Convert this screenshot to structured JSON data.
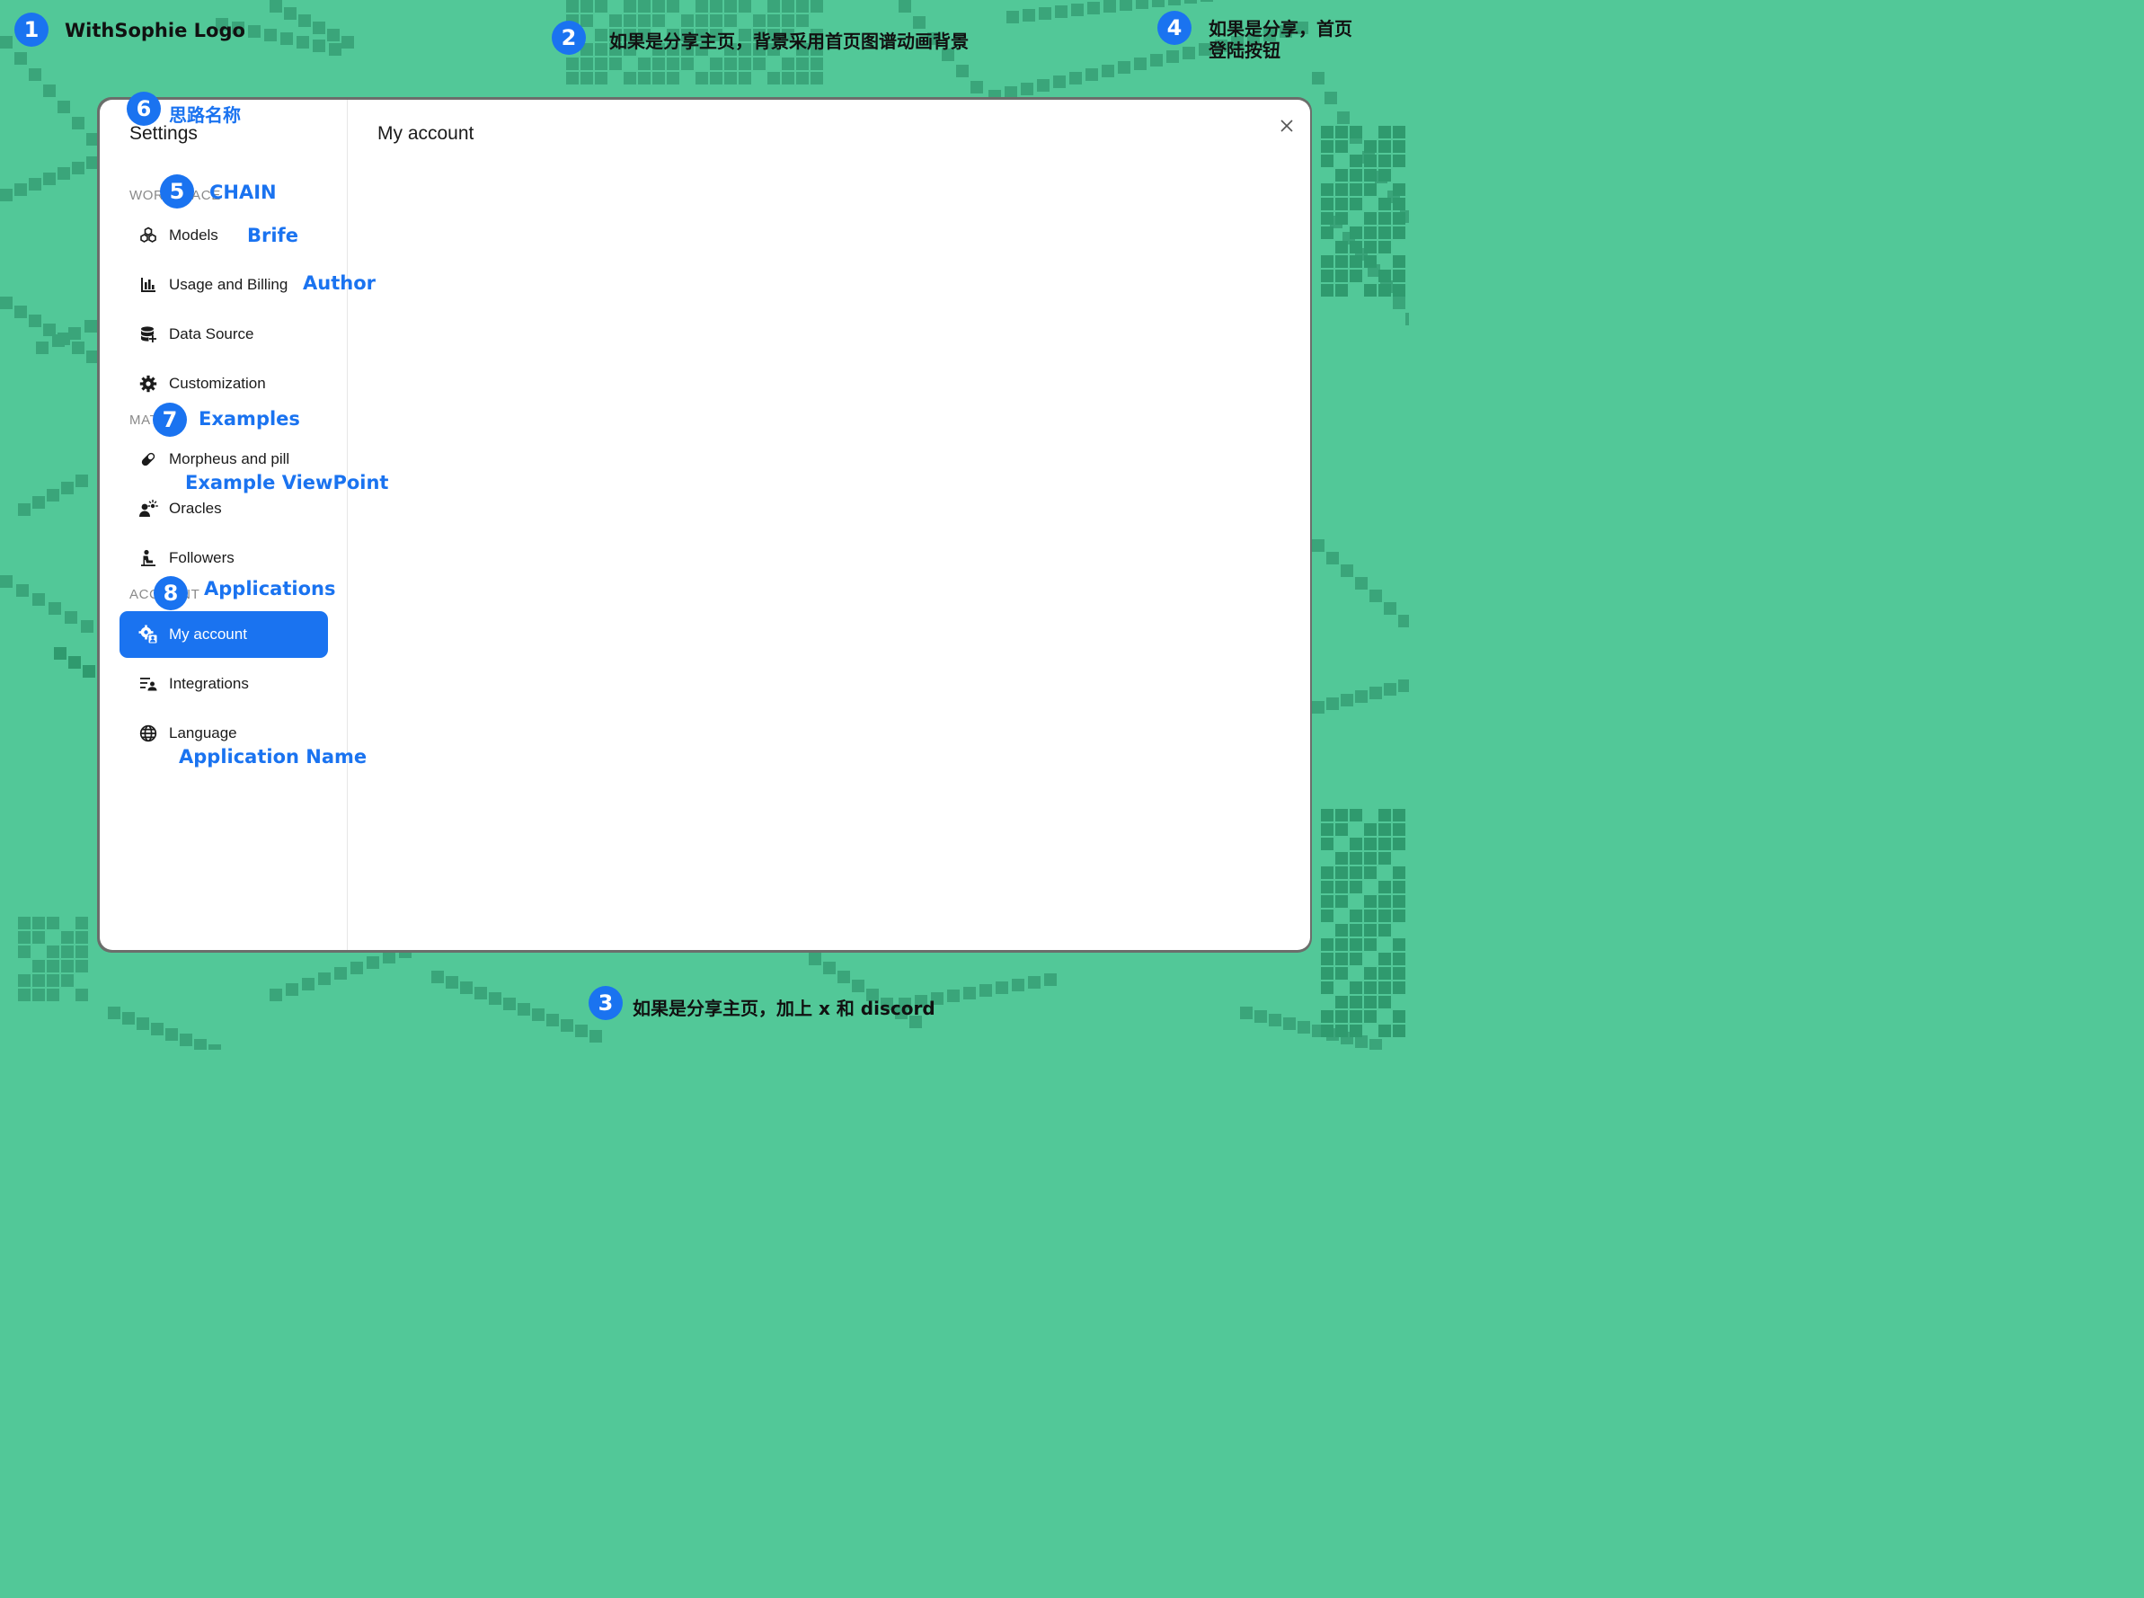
{
  "annotations": {
    "n1": {
      "num": "1",
      "text": "WithSophie Logo"
    },
    "n2": {
      "num": "2",
      "text": "如果是分享主页，背景采用首页图谱动画背景"
    },
    "n3": {
      "num": "3",
      "text": "如果是分享主页，加上 x 和 discord"
    },
    "n4": {
      "num": "4",
      "line1": "如果是分享，首页",
      "line2": "登陆按钮"
    },
    "n5": {
      "num": "5",
      "text": "CHAIN"
    },
    "n6": {
      "num": "6",
      "text": "思路名称"
    },
    "n7": {
      "num": "7",
      "text": "Examples"
    },
    "n8": {
      "num": "8",
      "text": "Applications"
    },
    "brife": "Brife",
    "author": "Author",
    "example_viewpoint": "Example ViewPoint",
    "application_name": "Application Name"
  },
  "settings": {
    "title": "Settings",
    "sections": {
      "workspace": "WORKSPACE",
      "material": "MAT",
      "account": "ACCOUNT"
    },
    "items": [
      {
        "label": "Models",
        "icon": "cubes-icon"
      },
      {
        "label": "Usage and Billing",
        "icon": "bar-chart-icon"
      },
      {
        "label": "Data Source",
        "icon": "database-add-icon"
      },
      {
        "label": "Customization",
        "icon": "gear-icon"
      },
      {
        "label": "Morpheus and pill",
        "icon": "pill-icon"
      },
      {
        "label": "Oracles",
        "icon": "person-idea-icon"
      },
      {
        "label": "Followers",
        "icon": "person-seated-icon"
      },
      {
        "label": "My account",
        "icon": "user-gear-icon",
        "active": true
      },
      {
        "label": "Integrations",
        "icon": "list-person-icon"
      },
      {
        "label": "Language",
        "icon": "globe-icon"
      }
    ]
  },
  "content": {
    "title": "My account"
  },
  "colors": {
    "accent": "#1a73f0",
    "background": "#52c898",
    "pixel": "#3aa57a"
  }
}
